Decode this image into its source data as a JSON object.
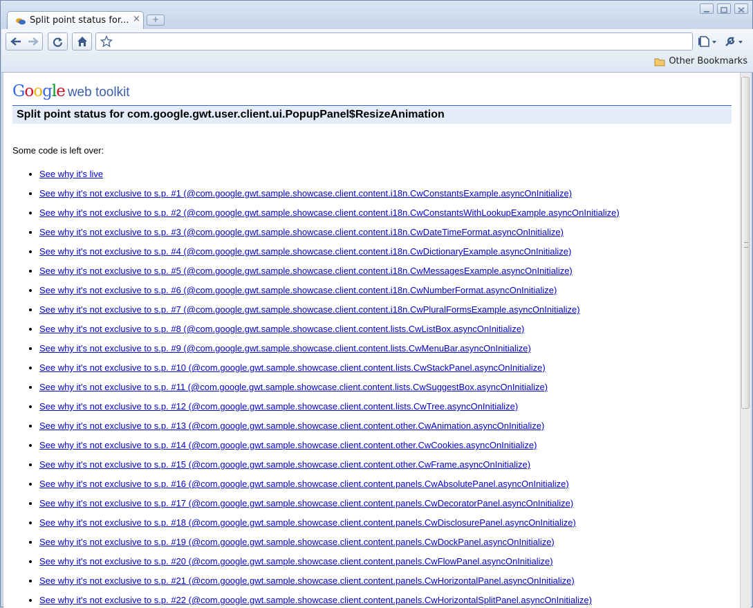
{
  "browser": {
    "tab_title": "Split point status for...",
    "tab_close": "×",
    "new_tab": "+",
    "address_value": "",
    "other_bookmarks": "Other Bookmarks"
  },
  "page": {
    "logo_google": "Google",
    "logo_sub": "web toolkit",
    "title": "Split point status for com.google.gwt.user.client.ui.PopupPanel$ResizeAnimation",
    "intro": "Some code is left over:",
    "links": [
      "See why it's live",
      "See why it's not exclusive to s.p. #1 (@com.google.gwt.sample.showcase.client.content.i18n.CwConstantsExample.asyncOnInitialize)",
      "See why it's not exclusive to s.p. #2 (@com.google.gwt.sample.showcase.client.content.i18n.CwConstantsWithLookupExample.asyncOnInitialize)",
      "See why it's not exclusive to s.p. #3 (@com.google.gwt.sample.showcase.client.content.i18n.CwDateTimeFormat.asyncOnInitialize)",
      "See why it's not exclusive to s.p. #4 (@com.google.gwt.sample.showcase.client.content.i18n.CwDictionaryExample.asyncOnInitialize)",
      "See why it's not exclusive to s.p. #5 (@com.google.gwt.sample.showcase.client.content.i18n.CwMessagesExample.asyncOnInitialize)",
      "See why it's not exclusive to s.p. #6 (@com.google.gwt.sample.showcase.client.content.i18n.CwNumberFormat.asyncOnInitialize)",
      "See why it's not exclusive to s.p. #7 (@com.google.gwt.sample.showcase.client.content.i18n.CwPluralFormsExample.asyncOnInitialize)",
      "See why it's not exclusive to s.p. #8 (@com.google.gwt.sample.showcase.client.content.lists.CwListBox.asyncOnInitialize)",
      "See why it's not exclusive to s.p. #9 (@com.google.gwt.sample.showcase.client.content.lists.CwMenuBar.asyncOnInitialize)",
      "See why it's not exclusive to s.p. #10 (@com.google.gwt.sample.showcase.client.content.lists.CwStackPanel.asyncOnInitialize)",
      "See why it's not exclusive to s.p. #11 (@com.google.gwt.sample.showcase.client.content.lists.CwSuggestBox.asyncOnInitialize)",
      "See why it's not exclusive to s.p. #12 (@com.google.gwt.sample.showcase.client.content.lists.CwTree.asyncOnInitialize)",
      "See why it's not exclusive to s.p. #13 (@com.google.gwt.sample.showcase.client.content.other.CwAnimation.asyncOnInitialize)",
      "See why it's not exclusive to s.p. #14 (@com.google.gwt.sample.showcase.client.content.other.CwCookies.asyncOnInitialize)",
      "See why it's not exclusive to s.p. #15 (@com.google.gwt.sample.showcase.client.content.other.CwFrame.asyncOnInitialize)",
      "See why it's not exclusive to s.p. #16 (@com.google.gwt.sample.showcase.client.content.panels.CwAbsolutePanel.asyncOnInitialize)",
      "See why it's not exclusive to s.p. #17 (@com.google.gwt.sample.showcase.client.content.panels.CwDecoratorPanel.asyncOnInitialize)",
      "See why it's not exclusive to s.p. #18 (@com.google.gwt.sample.showcase.client.content.panels.CwDisclosurePanel.asyncOnInitialize)",
      "See why it's not exclusive to s.p. #19 (@com.google.gwt.sample.showcase.client.content.panels.CwDockPanel.asyncOnInitialize)",
      "See why it's not exclusive to s.p. #20 (@com.google.gwt.sample.showcase.client.content.panels.CwFlowPanel.asyncOnInitialize)",
      "See why it's not exclusive to s.p. #21 (@com.google.gwt.sample.showcase.client.content.panels.CwHorizontalPanel.asyncOnInitialize)",
      "See why it's not exclusive to s.p. #22 (@com.google.gwt.sample.showcase.client.content.panels.CwHorizontalSplitPanel.asyncOnInitialize)"
    ]
  },
  "icons": {
    "back": "arrow-left-icon",
    "forward": "arrow-right-icon",
    "reload": "reload-icon",
    "home": "home-icon",
    "star": "star-icon",
    "go": "play-icon",
    "page_menu": "page-icon",
    "wrench_menu": "wrench-icon",
    "folder": "folder-icon"
  },
  "colors": {
    "link": "#0000cc",
    "title_bar_bg": "#e5ecf9",
    "title_bar_border": "#3366cc"
  }
}
